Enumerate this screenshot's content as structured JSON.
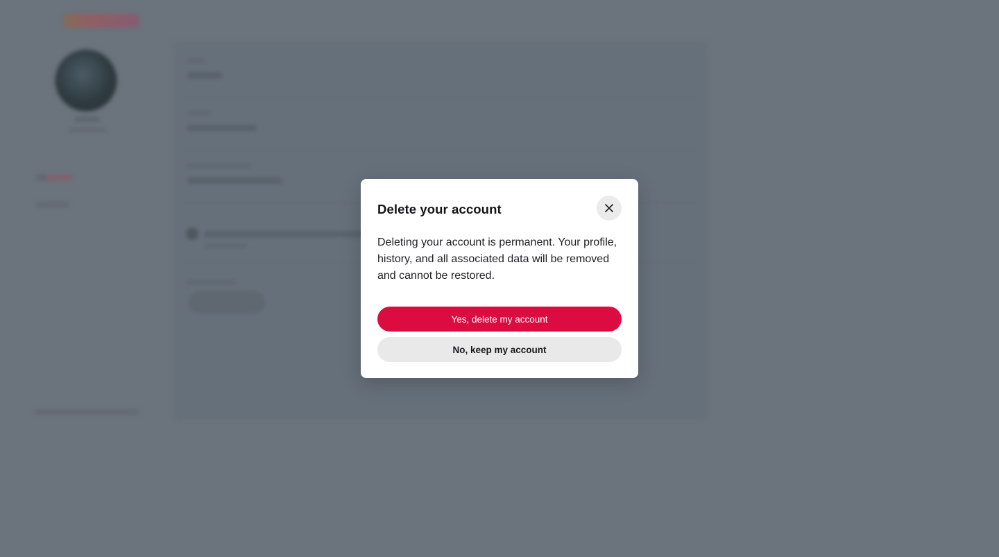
{
  "modal": {
    "title": "Delete your account",
    "body": "Deleting your account is permanent. Your profile, history, and all associated data will be removed and cannot be restored.",
    "confirm_label": "Yes, delete my account",
    "cancel_label": "No, keep my account",
    "close_icon": "close-icon"
  },
  "colors": {
    "overlay": "#6b737c",
    "danger": "#dc0c41",
    "secondary": "#e9e9ea"
  }
}
